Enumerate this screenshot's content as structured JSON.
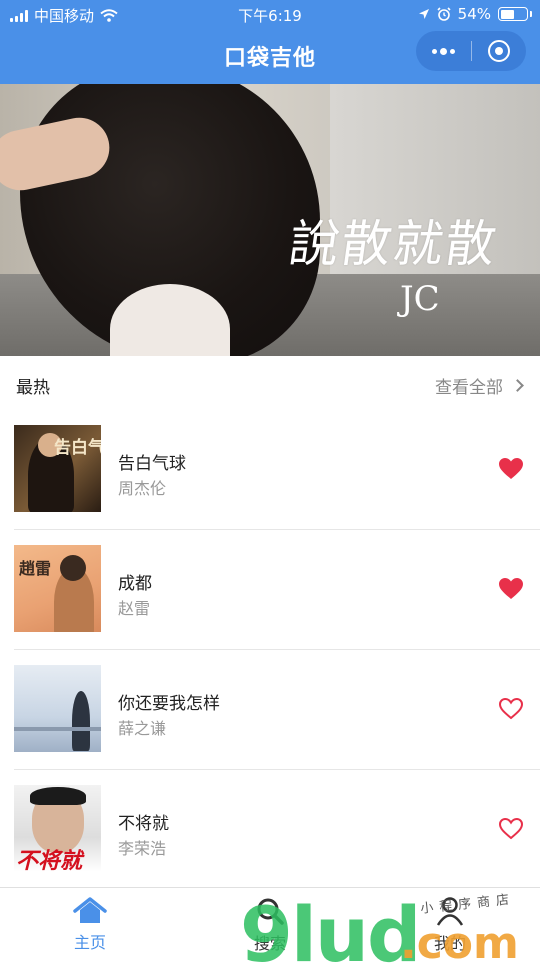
{
  "status_bar": {
    "carrier": "中国移动",
    "time": "下午6:19",
    "battery": "54%",
    "battery_level": 0.54
  },
  "nav": {
    "title": "口袋吉他",
    "more_icon": "more-dots-icon",
    "close_icon": "target-icon"
  },
  "banner": {
    "calligraphy": "說散就散",
    "artist_mark": "JC"
  },
  "section": {
    "title": "最热",
    "view_all": "查看全部"
  },
  "songs": [
    {
      "title": "告白气球",
      "artist": "周杰伦",
      "favorited": true,
      "cover_text": "告白气"
    },
    {
      "title": "成都",
      "artist": "赵雷",
      "favorited": true,
      "cover_text": "趙雷"
    },
    {
      "title": "你还要我怎样",
      "artist": "薛之谦",
      "favorited": false,
      "cover_text": ""
    },
    {
      "title": "不将就",
      "artist": "李荣浩",
      "favorited": false,
      "cover_text": "不将就"
    }
  ],
  "tabs": [
    {
      "label": "主页",
      "icon": "home-icon",
      "active": true
    },
    {
      "label": "搜索",
      "icon": "search-icon",
      "active": false
    },
    {
      "label": "我的",
      "icon": "user-icon",
      "active": false
    }
  ],
  "watermark": {
    "main": "9lud",
    "suffix": ".com",
    "small": "小程序商店"
  },
  "colors": {
    "primary": "#4a90e8",
    "heart": "#e8304a",
    "tab_active": "#4a90e8",
    "tab_inactive": "#333333"
  }
}
